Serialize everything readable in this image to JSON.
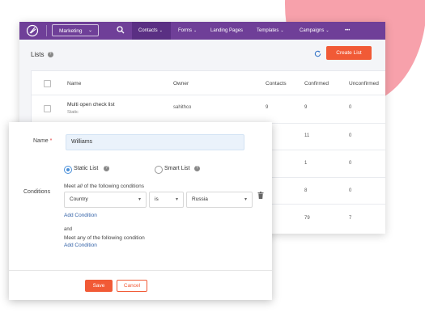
{
  "colors": {
    "nav": "#6f3f98",
    "accent": "#f15a36",
    "blob": "#f7a1ab",
    "link": "#2f5fa6"
  },
  "nav": {
    "logo_icon": "brand-logo-icon",
    "marketing_select": "Marketing",
    "search_icon": "search-icon",
    "items": [
      "Contacts",
      "Forms",
      "Landing Pages",
      "Templates",
      "Campaigns",
      "•••"
    ]
  },
  "lists": {
    "title": "Lists",
    "create_label": "Create List",
    "columns": [
      "Name",
      "Owner",
      "Contacts",
      "Confirmed",
      "Unconfirmed"
    ],
    "row1": {
      "name": "Multi open check list",
      "type": "Static",
      "owner": "sahithco",
      "contacts": "9",
      "confirmed": "9",
      "unconfirmed": "0"
    },
    "confirmed_col": [
      "11",
      "1",
      "8",
      "79"
    ],
    "unconfirmed_col": [
      "0",
      "0",
      "0",
      "7"
    ]
  },
  "modal": {
    "name_label": "Name",
    "required_mark": "*",
    "name_value": "Williams",
    "static_list": "Static List",
    "smart_list": "Smart List",
    "conditions_label": "Conditions",
    "meet_all_prefix": "Meet ",
    "meet_all_em": "all",
    "meet_all_suffix": " of the following conditions",
    "cond_field": "Country",
    "cond_op": "is",
    "cond_value": "Russia",
    "add_condition": "Add Condition",
    "and": "and",
    "meet_any": "Meet any of the following condition",
    "add_condition_2": "Add Condition",
    "save": "Save",
    "cancel": "Cancel"
  }
}
